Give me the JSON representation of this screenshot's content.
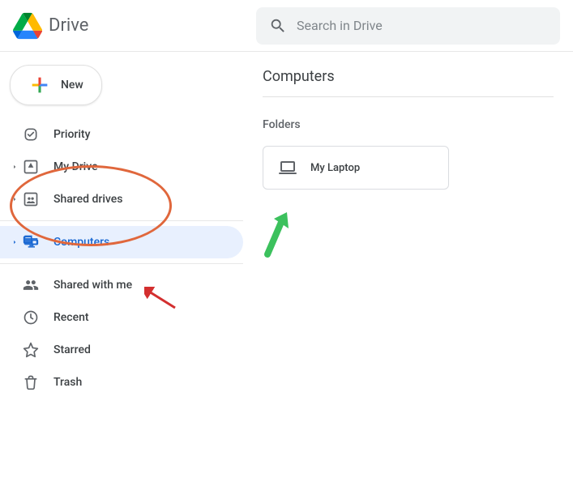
{
  "header": {
    "app_name": "Drive",
    "search_placeholder": "Search in Drive"
  },
  "sidebar": {
    "new_label": "New",
    "items": [
      {
        "icon": "priority-icon",
        "label": "Priority",
        "expandable": false,
        "active": false
      },
      {
        "icon": "my-drive-icon",
        "label": "My Drive",
        "expandable": true,
        "active": false
      },
      {
        "icon": "shared-drives-icon",
        "label": "Shared drives",
        "expandable": true,
        "active": false
      },
      {
        "icon": "computers-icon",
        "label": "Computers",
        "expandable": true,
        "active": true
      },
      {
        "icon": "shared-with-me-icon",
        "label": "Shared with me",
        "expandable": false,
        "active": false
      },
      {
        "icon": "recent-icon",
        "label": "Recent",
        "expandable": false,
        "active": false
      },
      {
        "icon": "starred-icon",
        "label": "Starred",
        "expandable": false,
        "active": false
      },
      {
        "icon": "trash-icon",
        "label": "Trash",
        "expandable": false,
        "active": false
      }
    ]
  },
  "main": {
    "title": "Computers",
    "section_label": "Folders",
    "folders": [
      {
        "icon": "laptop-icon",
        "label": "My Laptop"
      }
    ]
  },
  "annotations": {
    "ellipse_target": "My Drive & Shared drives",
    "red_arrow_target": "Computers",
    "green_arrow_target": "My Laptop"
  },
  "colors": {
    "active_bg": "#e8f0fe",
    "active_fg": "#1967d2",
    "ellipse": "#e0673c",
    "green_arrow": "#3cc15d",
    "red_arrow": "#d32f2f"
  }
}
